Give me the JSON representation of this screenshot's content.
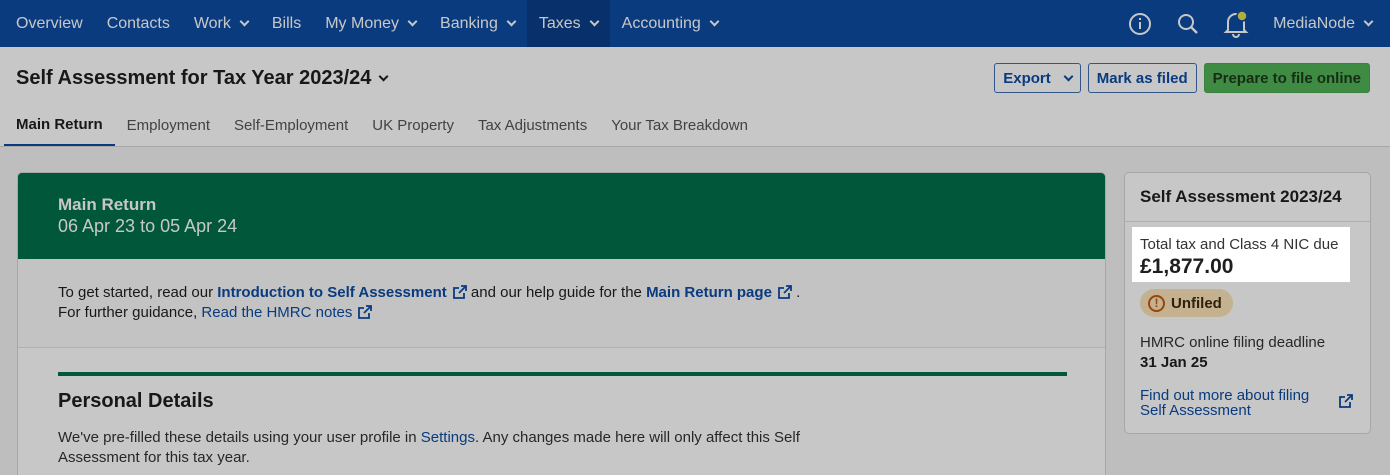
{
  "nav": {
    "items": [
      {
        "label": "Overview",
        "dropdown": false
      },
      {
        "label": "Contacts",
        "dropdown": false
      },
      {
        "label": "Work",
        "dropdown": true
      },
      {
        "label": "Bills",
        "dropdown": false
      },
      {
        "label": "My Money",
        "dropdown": true
      },
      {
        "label": "Banking",
        "dropdown": true
      },
      {
        "label": "Taxes",
        "dropdown": true,
        "active": true
      },
      {
        "label": "Accounting",
        "dropdown": true
      }
    ],
    "org_name": "MediaNode",
    "icons": [
      "info-icon",
      "search-icon",
      "notification-bell-icon"
    ]
  },
  "header": {
    "title": "Self Assessment for Tax Year 2023/24",
    "export_label": "Export",
    "mark_filed_label": "Mark as filed",
    "prepare_label": "Prepare to file online"
  },
  "tabs": [
    {
      "label": "Main Return",
      "active": true
    },
    {
      "label": "Employment"
    },
    {
      "label": "Self-Employment"
    },
    {
      "label": "UK Property"
    },
    {
      "label": "Tax Adjustments"
    },
    {
      "label": "Your Tax Breakdown"
    }
  ],
  "main": {
    "banner_title": "Main Return",
    "banner_dates": "06 Apr 23 to 05 Apr 24",
    "intro_prefix": "To get started, read our",
    "intro_link": "Introduction to Self Assessment",
    "intro_middle": "and our help guide for the",
    "intro_link2": "Main Return page",
    "intro_end": ".",
    "guidance_prefix": "For further guidance,",
    "guidance_link": "Read the HMRC notes",
    "section_title": "Personal Details",
    "section_text_prefix": "We've pre-filled these details using your user profile in",
    "section_text_link": "Settings",
    "section_text_suffix": ". Any changes made here will only affect this Self Assessment for this tax year."
  },
  "side": {
    "title": "Self Assessment 2023/24",
    "tax_label": "Total tax and Class 4 NIC due",
    "tax_value": "£1,877.00",
    "status": "Unfiled",
    "deadline_label": "HMRC online filing deadline",
    "deadline_value": "31 Jan 25",
    "link_text": "Find out more about filing Self Assessment"
  },
  "colors": {
    "nav_bg": "#0d4ca3",
    "banner_green": "#00704a",
    "prepare_green": "#51b256",
    "badge_bg": "#fbe3b8"
  }
}
